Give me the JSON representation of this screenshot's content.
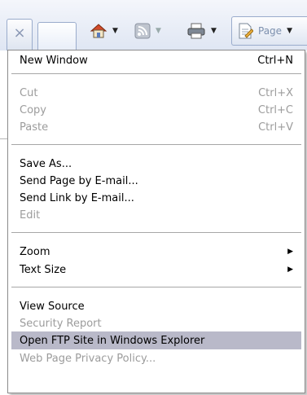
{
  "toolbar": {
    "close_glyph": "×",
    "page_label": "Page",
    "icons": [
      "close-icon",
      "home-icon",
      "feeds-icon",
      "print-icon",
      "page-icon"
    ]
  },
  "menu": {
    "new_window": {
      "label": "New Window",
      "shortcut": "Ctrl+N"
    },
    "cut": {
      "label": "Cut",
      "shortcut": "Ctrl+X"
    },
    "copy": {
      "label": "Copy",
      "shortcut": "Ctrl+C"
    },
    "paste": {
      "label": "Paste",
      "shortcut": "Ctrl+V"
    },
    "save_as": {
      "label": "Save As..."
    },
    "send_page": {
      "label": "Send Page by E-mail..."
    },
    "send_link": {
      "label": "Send Link by E-mail..."
    },
    "edit": {
      "label": "Edit"
    },
    "zoom": {
      "label": "Zoom"
    },
    "text_size": {
      "label": "Text Size"
    },
    "view_source": {
      "label": "View Source"
    },
    "security_report": {
      "label": "Security Report"
    },
    "open_ftp": {
      "label": "Open FTP Site in Windows Explorer"
    },
    "privacy_policy": {
      "label": "Web Page Privacy Policy..."
    }
  },
  "colors": {
    "highlight": "#b9b9c9",
    "disabled_text": "#9c9c9c"
  }
}
